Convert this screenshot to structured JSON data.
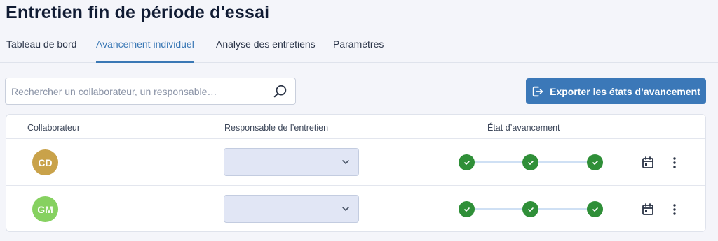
{
  "page": {
    "title": "Entretien fin de période d'essai"
  },
  "tabs": [
    {
      "label": "Tableau de bord",
      "active": false
    },
    {
      "label": "Avancement individuel",
      "active": true
    },
    {
      "label": "Analyse des entretiens",
      "active": false
    },
    {
      "label": "Paramètres",
      "active": false
    }
  ],
  "search": {
    "placeholder": "Rechercher un collaborateur, un responsable…",
    "value": "",
    "icon": "search-icon"
  },
  "export_button": {
    "label": "Exporter les états d’avancement",
    "icon": "export-icon"
  },
  "table": {
    "columns": [
      "Collaborateur",
      "Responsable de l’entretien",
      "État d’avancement"
    ],
    "rows": [
      {
        "initials": "CD",
        "avatar_color": "#c9a24a",
        "responsable": "",
        "steps": [
          "done",
          "done",
          "done"
        ]
      },
      {
        "initials": "GM",
        "avatar_color": "#86d160",
        "responsable": "",
        "steps": [
          "done",
          "done",
          "done"
        ]
      }
    ]
  },
  "colors": {
    "accent": "#3b78b8",
    "step_done": "#2f8f38",
    "progress_line": "#cfe0f4"
  }
}
